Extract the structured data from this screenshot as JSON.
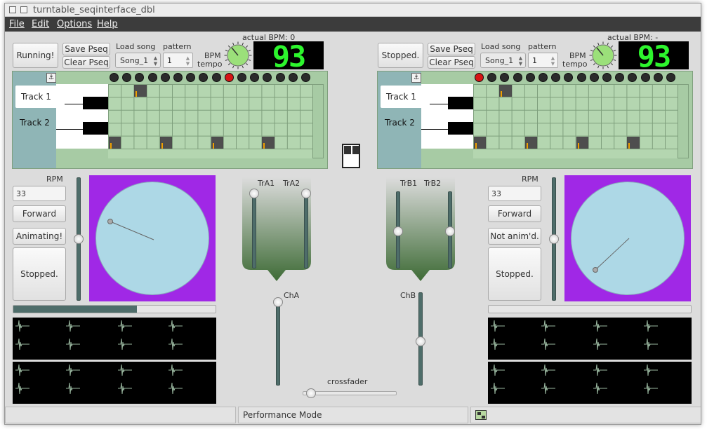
{
  "window": {
    "title": "turntable_seqinterface_dbl"
  },
  "menu": [
    "File",
    "Edit",
    "Options",
    "Help"
  ],
  "left": {
    "run_label": "Running!",
    "save_pseq": "Save Pseq",
    "clear_pseq": "Clear Pseq",
    "load_song_label": "Load song",
    "song": "Song_1",
    "pattern_label": "pattern",
    "pattern": "1",
    "bpm_label": "BPM",
    "tempo_label": "tempo",
    "actual_bpm": "actual BPM: 0",
    "lcd": "93",
    "track1": "Track 1",
    "track2": "Track 2",
    "pin": "⚓",
    "rpm_label": "RPM",
    "rpm": "33",
    "direction": "Forward",
    "anim": "Animating!",
    "state": "Stopped.",
    "progress": 0.61,
    "slider_level": 0.5
  },
  "right": {
    "run_label": "Stopped.",
    "save_pseq": "Save Pseq",
    "clear_pseq": "Clear Pseq",
    "load_song_label": "Load song",
    "song": "Song_1",
    "pattern_label": "pattern",
    "pattern": "1",
    "bpm_label": "BPM",
    "tempo_label": "tempo",
    "actual_bpm": "actual BPM: -",
    "lcd": "93",
    "track1": "Track 1",
    "track2": "Track 2",
    "pin": "⚓",
    "rpm_label": "RPM",
    "rpm": "33",
    "direction": "Forward",
    "anim": "Not anim'd.",
    "state": "Stopped.",
    "progress": 0,
    "slider_level": 0.5
  },
  "mixer": {
    "tra1": "TrA1",
    "tra2": "TrA2",
    "trb1": "TrB1",
    "trb2": "TrB2",
    "cha": "ChA",
    "chb": "ChB",
    "crossfader": "crossfader"
  },
  "status": {
    "mode": "Performance Mode"
  }
}
